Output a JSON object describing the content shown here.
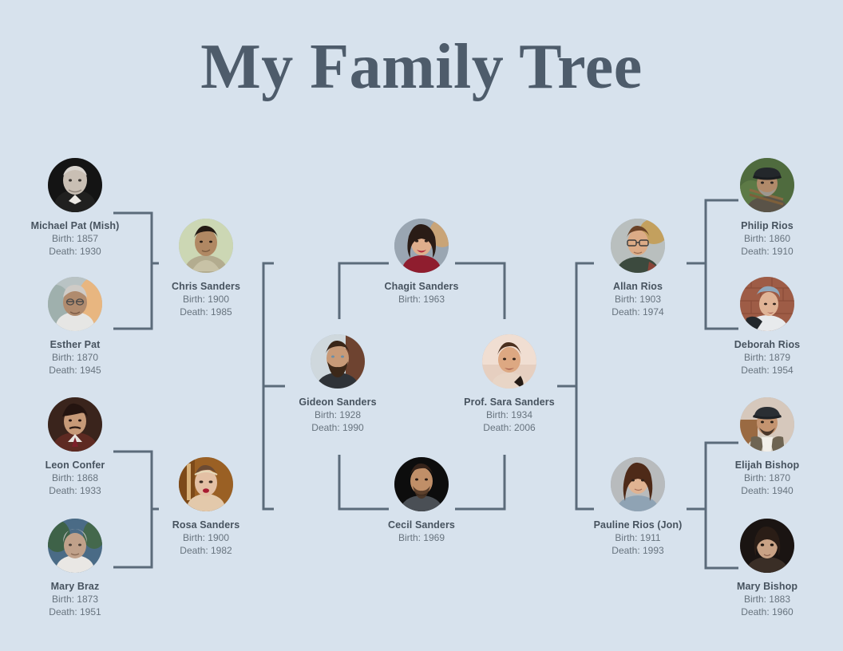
{
  "header": {
    "title": "My Family Tree"
  },
  "colors": {
    "background": "#d7e2ed",
    "title": "#4e5c6b",
    "name_text": "#47535f",
    "date_text": "#67737e",
    "connector": "#5b6b7a"
  },
  "labels": {
    "birth_prefix": "Birth: ",
    "death_prefix": "Death: "
  },
  "chart_data": {
    "type": "diagram",
    "diagram_kind": "family-tree",
    "title": "My Family Tree",
    "generations": 4,
    "people": [
      {
        "id": "michael",
        "name": "Michael Pat (Mish)",
        "birth": "1857",
        "death": "1930",
        "column": 1,
        "row": 1
      },
      {
        "id": "esther",
        "name": "Esther Pat",
        "birth": "1870",
        "death": "1945",
        "column": 1,
        "row": 2
      },
      {
        "id": "leon",
        "name": "Leon Confer",
        "birth": "1868",
        "death": "1933",
        "column": 1,
        "row": 3
      },
      {
        "id": "mary_b",
        "name": "Mary Braz",
        "birth": "1873",
        "death": "1951",
        "column": 1,
        "row": 4
      },
      {
        "id": "chris",
        "name": "Chris Sanders",
        "birth": "1900",
        "death": "1985",
        "column": 2,
        "row": 1
      },
      {
        "id": "rosa",
        "name": "Rosa Sanders",
        "birth": "1900",
        "death": "1982",
        "column": 2,
        "row": 2
      },
      {
        "id": "gideon",
        "name": "Gideon Sanders",
        "birth": "1928",
        "death": "1990",
        "column": 3,
        "row": 1
      },
      {
        "id": "chagit",
        "name": "Chagit Sanders",
        "birth": "1963",
        "death": "",
        "column": 4,
        "row": 1
      },
      {
        "id": "cecil",
        "name": "Cecil Sanders",
        "birth": "1969",
        "death": "",
        "column": 4,
        "row": 2
      },
      {
        "id": "sara",
        "name": "Prof. Sara Sanders",
        "birth": "1934",
        "death": "2006",
        "column": 5,
        "row": 1
      },
      {
        "id": "allan",
        "name": "Allan Rios",
        "birth": "1903",
        "death": "1974",
        "column": 6,
        "row": 1
      },
      {
        "id": "pauline",
        "name": "Pauline Rios (Jon)",
        "birth": "1911",
        "death": "1993",
        "column": 6,
        "row": 2
      },
      {
        "id": "philip",
        "name": "Philip Rios",
        "birth": "1860",
        "death": "1910",
        "column": 7,
        "row": 1
      },
      {
        "id": "deborah",
        "name": "Deborah Rios",
        "birth": "1879",
        "death": "1954",
        "column": 7,
        "row": 2
      },
      {
        "id": "elijah",
        "name": "Elijah Bishop",
        "birth": "1870",
        "death": "1940",
        "column": 7,
        "row": 3
      },
      {
        "id": "mary_bi",
        "name": "Mary Bishop",
        "birth": "1883",
        "death": "1960",
        "column": 7,
        "row": 4
      }
    ],
    "relationships": [
      {
        "parents": [
          "michael",
          "esther"
        ],
        "child": "chris"
      },
      {
        "parents": [
          "leon",
          "mary_b"
        ],
        "child": "rosa"
      },
      {
        "parents": [
          "chris",
          "rosa"
        ],
        "child": "gideon"
      },
      {
        "parents": [
          "philip",
          "deborah"
        ],
        "child": "allan"
      },
      {
        "parents": [
          "elijah",
          "mary_bi"
        ],
        "child": "pauline"
      },
      {
        "parents": [
          "allan",
          "pauline"
        ],
        "child": "sara"
      },
      {
        "parents": [
          "gideon",
          "sara"
        ],
        "child": "chagit"
      },
      {
        "parents": [
          "gideon",
          "sara"
        ],
        "child": "cecil"
      }
    ]
  }
}
